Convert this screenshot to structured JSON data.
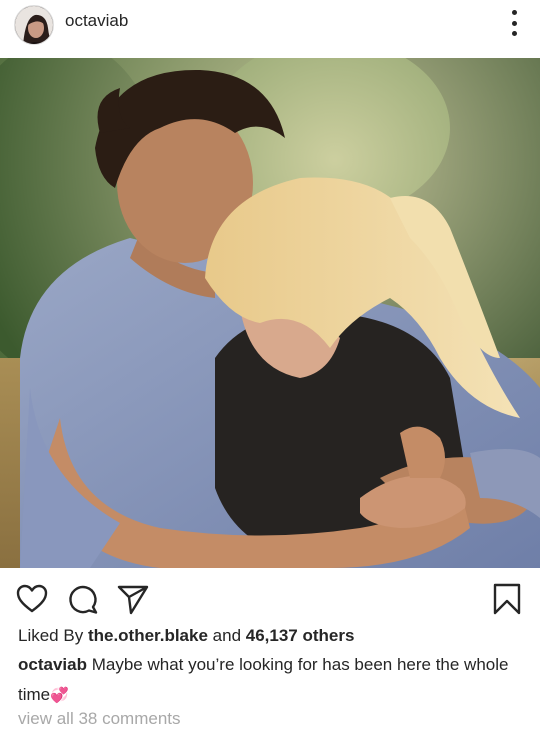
{
  "post": {
    "username": "octaviab",
    "image_alt": "Couple hugging outdoors in sunlight"
  },
  "icons": {
    "like": "heart-icon",
    "comment": "comment-icon",
    "share": "send-icon",
    "save": "bookmark-icon",
    "more": "more-options-icon"
  },
  "likes": {
    "prefix": "Liked By",
    "user": "the.other.blake",
    "middle": "and",
    "count": "46,137 others"
  },
  "caption": {
    "username": "octaviab",
    "text": "Maybe what you’re looking for has been here the whole time",
    "emoji": "💞"
  },
  "comments": {
    "label": "view all 38 comments"
  },
  "colors": {
    "text": "#262626",
    "muted": "#a8a8a8",
    "background": "#ffffff"
  }
}
